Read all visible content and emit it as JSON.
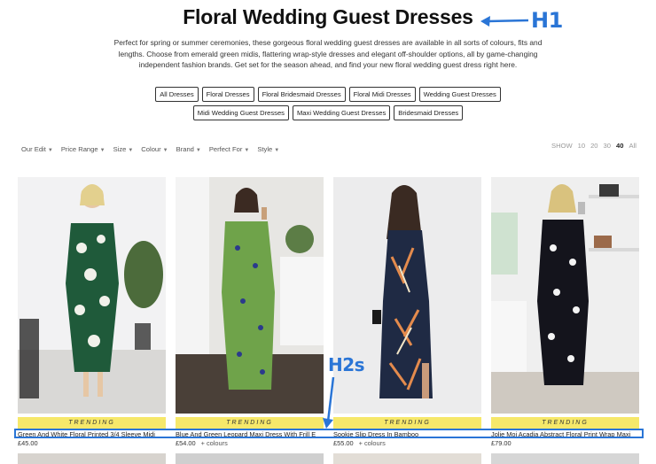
{
  "page": {
    "h1": "Floral Wedding Guest Dresses",
    "intro": "Perfect for spring or summer ceremonies, these gorgeous floral wedding guest dresses are available in all sorts of colours, fits and lengths. Choose from emerald green midis, flattering wrap-style dresses and elegant off-shoulder options, all by game-changing independent fashion brands. Get set for the season ahead, and find your new floral wedding guest dress right here."
  },
  "annotations": {
    "h1_label": "H1",
    "h2s_label": "H2s",
    "color": "#2a75d6"
  },
  "chips_row1": [
    "All Dresses",
    "Floral Dresses",
    "Floral Bridesmaid Dresses",
    "Floral Midi Dresses",
    "Wedding Guest Dresses"
  ],
  "chips_row2": [
    "Midi Wedding Guest Dresses",
    "Maxi Wedding Guest Dresses",
    "Bridesmaid Dresses"
  ],
  "filters": [
    "Our Edit",
    "Price Range",
    "Size",
    "Colour",
    "Brand",
    "Perfect For",
    "Style"
  ],
  "show": {
    "label": "SHOW",
    "options": [
      "10",
      "20",
      "30",
      "40",
      "All"
    ],
    "selected": "40"
  },
  "products": [
    {
      "badge": "TRENDING",
      "name": "Green And White Floral Printed 3/4 Sleeve Midi",
      "price": "£45.00",
      "colours": ""
    },
    {
      "badge": "TRENDING",
      "name": "Blue And Green Leopard Maxi Dress With Frill E",
      "price": "£54.00",
      "colours": "+ colours"
    },
    {
      "badge": "TRENDING",
      "name": "Sookie Slip Dress In Bamboo",
      "price": "£55.00",
      "colours": "+ colours"
    },
    {
      "badge": "TRENDING",
      "name": "Jolie Moi Acadia Abstract Floral Print Wrap Maxi",
      "price": "£79.00",
      "colours": ""
    }
  ],
  "colors": {
    "badge": "#f6e86a",
    "annotation_blue": "#2a75d6"
  }
}
